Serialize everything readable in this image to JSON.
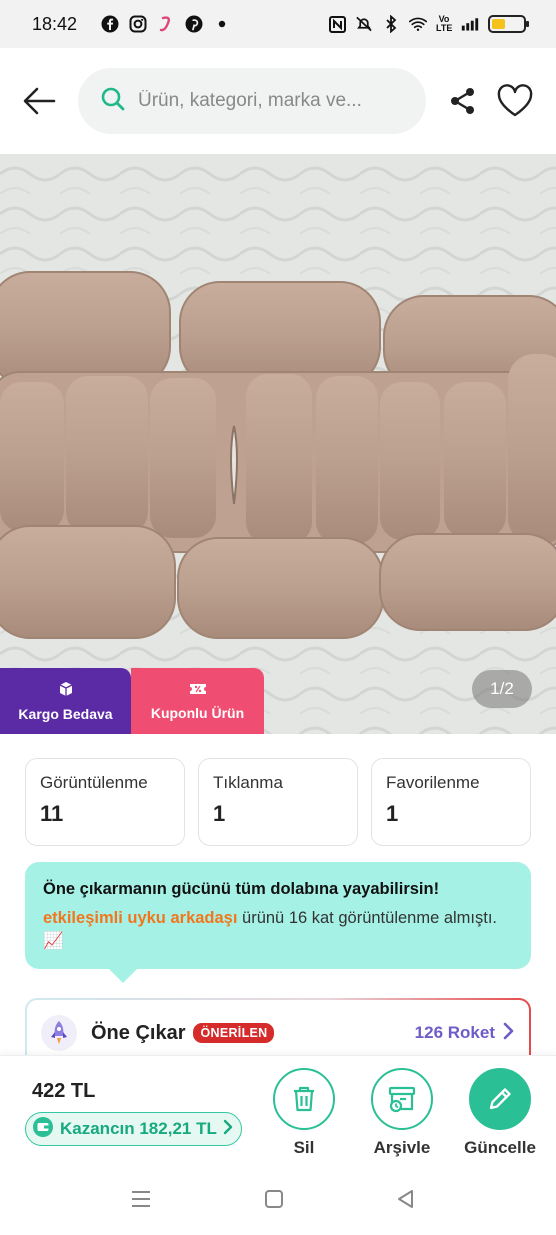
{
  "status_bar": {
    "time": "18:42",
    "app_icons": [
      "facebook-icon",
      "instagram-icon",
      "j-app-icon",
      "pinterest-icon",
      "dot-icon"
    ],
    "system_icons": [
      "nfc-icon",
      "mute-icon",
      "bluetooth-icon",
      "wifi-icon",
      "volte-icon",
      "signal-icon",
      "battery-icon"
    ],
    "volte_text": "Vo LTE",
    "battery_level": 0.42,
    "battery_color": "#f4c21b"
  },
  "header": {
    "search_placeholder": "Ürün, kategori, marka ve..."
  },
  "gallery": {
    "badges": [
      {
        "label": "Kargo Bedava",
        "icon": "box-icon",
        "color": "#5b2aa5"
      },
      {
        "label": "Kuponlu Ürün",
        "icon": "ticket-icon",
        "color": "#ef4d72"
      }
    ],
    "counter": "1/2"
  },
  "stats": [
    {
      "label": "Görüntülenme",
      "value": "11"
    },
    {
      "label": "Tıklanma",
      "value": "1"
    },
    {
      "label": "Favorilenme",
      "value": "1"
    }
  ],
  "promo": {
    "title": "Öne çıkarmanın gücünü tüm dolabına yayabilirsin!",
    "highlight": "etkileşimli uyku arkadaşı",
    "body_rest": " ürünü 16 kat görüntülenme almıştı. 📈"
  },
  "feature": {
    "title": "Öne Çıkar",
    "badge": "ÖNERİLEN",
    "link": "126 Roket"
  },
  "bottom_bar": {
    "price": "422 TL",
    "earnings": "Kazancın 182,21 TL",
    "actions": [
      {
        "label": "Sil",
        "icon": "trash-icon"
      },
      {
        "label": "Arşivle",
        "icon": "archive-icon"
      },
      {
        "label": "Güncelle",
        "icon": "pencil-icon"
      }
    ],
    "accent_color": "#2bbf95"
  },
  "nav_bar": {
    "icons": [
      "menu-icon",
      "home-square-icon",
      "back-triangle-icon"
    ]
  }
}
